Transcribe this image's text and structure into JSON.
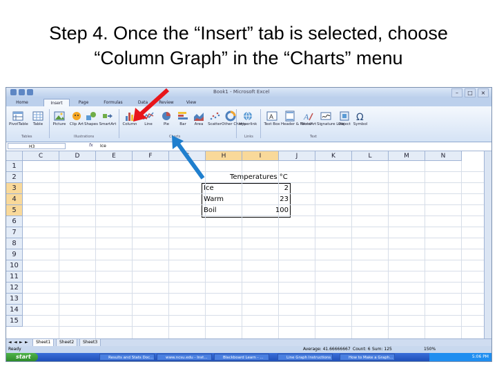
{
  "slide": {
    "title_line1": "Step 4. Once the “Insert” tab is selected, choose",
    "title_line2": "“Column Graph” in the “Charts” menu"
  },
  "window": {
    "title": "Book1 - Microsoft Excel"
  },
  "ribbon": {
    "tabs": [
      "Home",
      "Insert",
      "Page Layout",
      "Formulas",
      "Data",
      "Review",
      "View"
    ],
    "selected_tab": "Insert",
    "buttons": [
      {
        "label": "PivotTable",
        "icon": "pivottable-icon"
      },
      {
        "label": "Table",
        "icon": "table-icon"
      },
      {
        "label": "Picture",
        "icon": "picture-icon"
      },
      {
        "label": "Clip Art",
        "icon": "clipart-icon"
      },
      {
        "label": "Shapes",
        "icon": "shapes-icon"
      },
      {
        "label": "SmartArt",
        "icon": "smartart-icon"
      },
      {
        "label": "Column",
        "icon": "column-chart-icon"
      },
      {
        "label": "Line",
        "icon": "line-chart-icon"
      },
      {
        "label": "Pie",
        "icon": "pie-chart-icon"
      },
      {
        "label": "Bar",
        "icon": "bar-chart-icon"
      },
      {
        "label": "Area",
        "icon": "area-chart-icon"
      },
      {
        "label": "Scatter",
        "icon": "scatter-chart-icon"
      },
      {
        "label": "Other Charts",
        "icon": "other-charts-icon"
      },
      {
        "label": "Hyperlink",
        "icon": "hyperlink-icon"
      },
      {
        "label": "Text Box",
        "icon": "textbox-icon"
      },
      {
        "label": "Header & Footer",
        "icon": "header-footer-icon"
      },
      {
        "label": "WordArt",
        "icon": "wordart-icon"
      },
      {
        "label": "Signature Line",
        "icon": "signature-icon"
      },
      {
        "label": "Object",
        "icon": "object-icon"
      },
      {
        "label": "Symbol",
        "icon": "symbol-icon"
      }
    ],
    "groups": [
      "Tables",
      "Illustrations",
      "Charts",
      "Links",
      "Text"
    ]
  },
  "formula_bar": {
    "name_box": "H3",
    "fx": "fx",
    "value": "Ice"
  },
  "grid": {
    "columns": [
      "C",
      "D",
      "E",
      "F",
      "G",
      "H",
      "I",
      "J",
      "K",
      "L",
      "M",
      "N"
    ],
    "selected_columns": [
      "H",
      "I"
    ],
    "rows": [
      "1",
      "2",
      "3",
      "4",
      "5",
      "6",
      "7",
      "8",
      "9",
      "10",
      "11",
      "12",
      "13",
      "14",
      "15"
    ],
    "selected_rows": [
      "3",
      "4",
      "5"
    ],
    "table_header": "Temperatures °C",
    "table_rows": [
      {
        "label": "Ice",
        "value": "2"
      },
      {
        "label": "Warm",
        "value": "23"
      },
      {
        "label": "Boil",
        "value": "100"
      }
    ]
  },
  "sheets": {
    "tabs": [
      "Sheet1",
      "Sheet2",
      "Sheet3"
    ],
    "selected": "Sheet1"
  },
  "status": {
    "ready": "Ready",
    "average": "Average: 41.66666667",
    "count": "Count: 6",
    "sum": "Sum: 125",
    "zoom": "150%"
  },
  "taskbar": {
    "start": "start",
    "tasks": [
      "Results and Stats Doc...",
      "www.ncsu.edu - Inst...",
      "Blackboard Learn - ...",
      "Line Graph Instructions",
      "How to Make a Graph..."
    ],
    "clock": "5:06 PM"
  },
  "colors": {
    "arrow_red": "#e8161b",
    "arrow_blue": "#1f7fce",
    "header_selected": "#f9d99a"
  }
}
